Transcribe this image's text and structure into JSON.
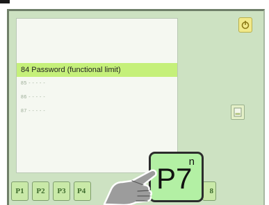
{
  "list": {
    "selected_item": "84 Password (functional limit)",
    "rows": [
      {
        "text": "85 - - - - -"
      },
      {
        "text": "86 - - - - -"
      },
      {
        "text": "87 - - - - -"
      }
    ]
  },
  "tabs": [
    {
      "label": "P1"
    },
    {
      "label": "P2"
    },
    {
      "label": "P3"
    },
    {
      "label": "P4"
    },
    {
      "label": "8"
    }
  ],
  "highlight_tab": {
    "label": "P7",
    "sup": "n"
  },
  "colors": {
    "screen_bg": "#cde2c2",
    "selected_row": "#c5f07a",
    "tab_bg": "#c9e9a8",
    "highlight_tab_bg": "#b3f0a4"
  },
  "icons": {
    "top_right": "power-icon",
    "side": "page-icon",
    "pointer": "hand-pointer-icon"
  }
}
